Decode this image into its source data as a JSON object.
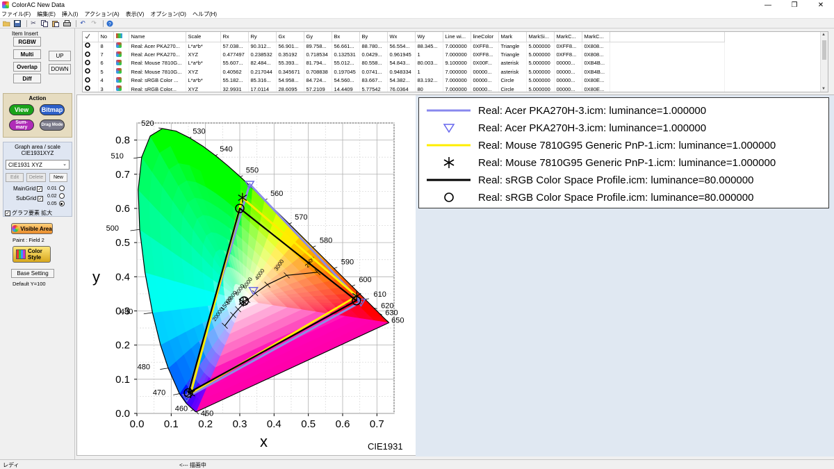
{
  "window": {
    "title": "ColorAC New Data",
    "min_icon": "minimize-icon",
    "max_icon": "maximize-icon",
    "close_icon": "close-icon"
  },
  "menu": [
    "ファイル(F)",
    "編集(E)",
    "挿入(I)",
    "アクション(A)",
    "表示(V)",
    "オプション(O)",
    "ヘルプ(H)"
  ],
  "toolbar": [
    "open-folder-icon",
    "save-icon",
    "cut-icon",
    "copy-icon",
    "paste-icon",
    "print-icon",
    "undo-icon",
    "redo-icon",
    "help-icon"
  ],
  "left": {
    "item_insert": {
      "title": "Item Insert",
      "rgbw": "RGBW",
      "multi": "Multi",
      "overlap": "Overlap",
      "diff": "Diff",
      "up": "UP",
      "down": "DOWN"
    },
    "action": {
      "title": "Action",
      "view": "View",
      "bitmap": "Bitmap",
      "summary": "Sum-mary",
      "drag": "Drag Mode"
    },
    "graph": {
      "title": "Graph area / scale",
      "subtitle": "CIE1931XYZ",
      "select_value": "CIE1931 XYZ",
      "edit": "Edit",
      "delete": "Delete",
      "new": "New",
      "maingrid": "MainGrid",
      "subgrid": "SubGrid",
      "radio1": "0.01",
      "radio2": "0.02",
      "radio3": "0.05",
      "enlarge": "グラフ要素 拡大"
    },
    "visible_area": "Visible Area",
    "paint": "Paint : Field 2",
    "color_style": "Color Style",
    "base_setting": "Base Setting",
    "default_y": "Default Y=100"
  },
  "table": {
    "headers": [
      "No",
      "Name",
      "Scale",
      "Rx",
      "Ry",
      "Gx",
      "Gy",
      "Bx",
      "By",
      "Wx",
      "Wy",
      "Line wi...",
      "lineColor",
      "Mark",
      "MarkSi...",
      "MarkC...",
      "MarkC..."
    ],
    "rows": [
      [
        "8",
        "Real: Acer PKA270...",
        "L*a*b*",
        "57.038...",
        "90.312...",
        "56.901...",
        "89.758...",
        "56.661...",
        "88.780...",
        "56.554...",
        "88.345...",
        "7.000000",
        "0XFF8...",
        "Triangle",
        "5.000000",
        "0XFF8...",
        "0X808..."
      ],
      [
        "7",
        "Real: Acer PKA270...",
        "XYZ",
        "0.477497",
        "0.238532",
        "0.35192",
        "0.718534",
        "0.132531",
        "0.0429...",
        "0.961945",
        "1",
        "7.000000",
        "0XFF8...",
        "Triangle",
        "5.000000",
        "0XFF8...",
        "0X808..."
      ],
      [
        "6",
        "Real: Mouse 7810G...",
        "L*a*b*",
        "55.607...",
        "82.484...",
        "55.393...",
        "81.794...",
        "55.012...",
        "80.558...",
        "54.843...",
        "80.003...",
        "9.100000",
        "0X00F...",
        "asterisk",
        "5.000000",
        "00000...",
        "0XB4B..."
      ],
      [
        "5",
        "Real: Mouse 7810G...",
        "XYZ",
        "0.40562",
        "0.217044",
        "0.345671",
        "0.708838",
        "0.197045",
        "0.0741...",
        "0.948334",
        "1",
        "7.000000",
        "00000...",
        "asterisk",
        "5.000000",
        "00000...",
        "0XB4B..."
      ],
      [
        "4",
        "Real: sRGB Color ...",
        "L*a*b*",
        "55.182...",
        "85.316...",
        "54.958...",
        "84.724...",
        "54.560...",
        "83.667...",
        "54.382...",
        "83.192...",
        "7.000000",
        "00000...",
        "Circle",
        "5.000000",
        "00000...",
        "0X80E..."
      ],
      [
        "3",
        "Real: sRGB Color...",
        "XYZ",
        "32.9931",
        "17.0114",
        "28.6095",
        "57.2109",
        "14.4409",
        "5.77542",
        "76.0364",
        "80",
        "7.000000",
        "00000...",
        "Circle",
        "5.000000",
        "00000...",
        "0X80E..."
      ]
    ]
  },
  "chart_data": {
    "type": "scatter",
    "subtype": "CIE1931 chromaticity diagram",
    "xlabel": "x",
    "ylabel": "y",
    "xlim": [
      0.0,
      0.75
    ],
    "ylim": [
      0.0,
      0.85
    ],
    "xticks": [
      "0.0",
      "0.1",
      "0.2",
      "0.3",
      "0.4",
      "0.5",
      "0.6",
      "0.7"
    ],
    "yticks": [
      "0.0",
      "0.1",
      "0.2",
      "0.3",
      "0.4",
      "0.5",
      "0.6",
      "0.7",
      "0.8"
    ],
    "corner_label": "CIE1931",
    "wavelength_labels": [
      "450",
      "460",
      "470",
      "480",
      "490",
      "500",
      "510",
      "520",
      "530",
      "540",
      "550",
      "560",
      "570",
      "580",
      "590",
      "600",
      "610",
      "620",
      "630",
      "650"
    ],
    "planck_labels": [
      "2000",
      "3000",
      "4000",
      "6000",
      "8000",
      "10000",
      "15000",
      "20000"
    ],
    "series": [
      {
        "name": "Real: Acer PKA270H-3.icm: luminance=1.000000",
        "color": "#8888ee",
        "marker": "triangle",
        "points": [
          [
            0.6535,
            0.3265
          ],
          [
            0.3287,
            0.6711
          ],
          [
            0.1456,
            0.0472
          ]
        ],
        "white": [
          0.3397,
          0.3604
        ]
      },
      {
        "name": "Real: Mouse 7810G95  Generic PnP-1.icm: luminance=1.000000",
        "color": "#ffee00",
        "marker": "asterisk",
        "points": [
          [
            0.6412,
            0.3431
          ],
          [
            0.3078,
            0.6312
          ],
          [
            0.1569,
            0.059
          ]
        ],
        "white": [
          0.3099,
          0.3267
        ]
      },
      {
        "name": "Real: sRGB Color Space Profile.icm: luminance=80.000000",
        "color": "#000000",
        "marker": "circle",
        "points": [
          [
            0.64,
            0.33
          ],
          [
            0.3,
            0.6
          ],
          [
            0.15,
            0.06
          ]
        ],
        "white": [
          0.3127,
          0.329
        ]
      }
    ]
  },
  "legend": [
    {
      "text": "Real: Acer PKA270H-3.icm: luminance=1.000000",
      "kind": "line",
      "color": "#8888ee"
    },
    {
      "text": "Real: Acer PKA270H-3.icm: luminance=1.000000",
      "kind": "triangle",
      "color": "#6666ee"
    },
    {
      "text": "Real: Mouse 7810G95  Generic PnP-1.icm: luminance=1.000000",
      "kind": "line",
      "color": "#ffee00"
    },
    {
      "text": "Real: Mouse 7810G95  Generic PnP-1.icm: luminance=1.000000",
      "kind": "asterisk",
      "color": "#000000"
    },
    {
      "text": "Real: sRGB Color Space Profile.icm: luminance=80.000000",
      "kind": "line",
      "color": "#000000"
    },
    {
      "text": "Real: sRGB Color Space Profile.icm: luminance=80.000000",
      "kind": "circle",
      "color": "#000000"
    }
  ],
  "status": {
    "left": "レディ",
    "middle": "<--- 描画中"
  }
}
